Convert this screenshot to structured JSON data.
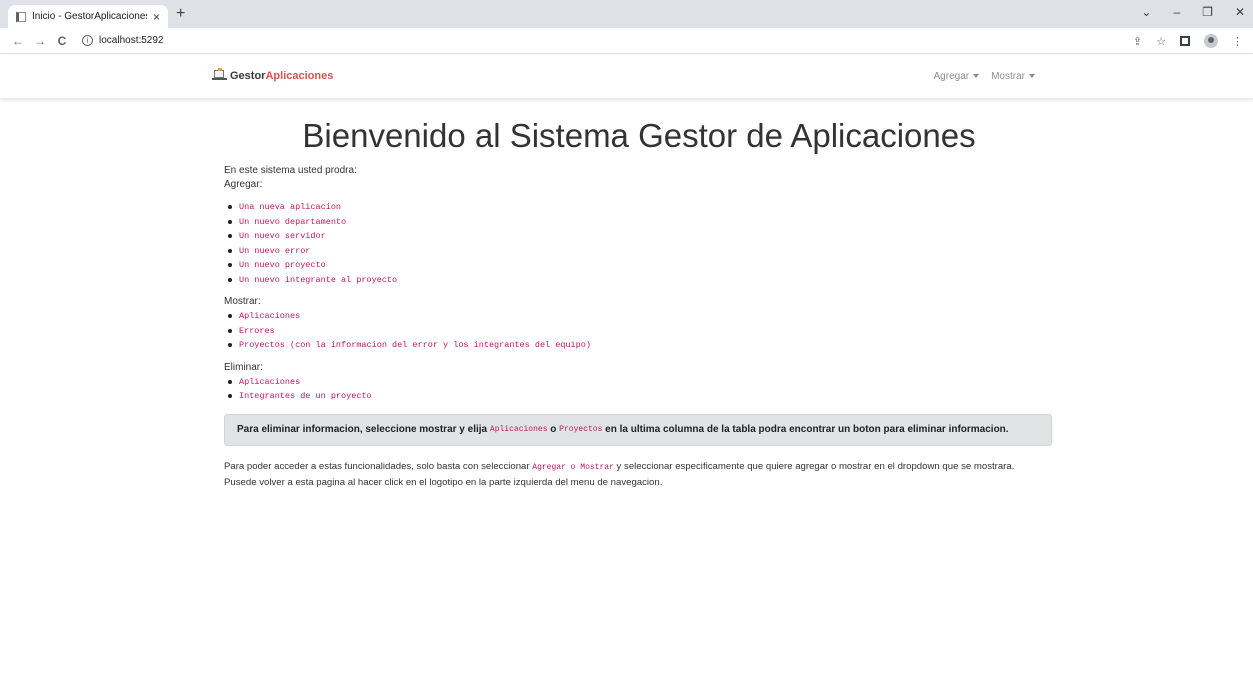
{
  "browser": {
    "tab_title": "Inicio - GestorAplicaciones",
    "tab_close": "×",
    "new_tab": "+",
    "url": "localhost:5292",
    "win_min": "⌄",
    "win_minimize": "–",
    "win_restore": "❐",
    "win_close": "✕",
    "back": "←",
    "forward": "→",
    "reload": "C",
    "share": "⇪",
    "star": "☆",
    "menu": "⋮"
  },
  "navbar": {
    "brand_part1": "Gestor",
    "brand_part2": "Aplicaciones",
    "agregar": "Agregar",
    "mostrar": "Mostrar"
  },
  "main": {
    "heading": "Bienvenido al Sistema Gestor de Aplicaciones",
    "intro": "En este sistema usted prodra:",
    "agregar_label": "Agregar:",
    "agregar_items": [
      "Una nueva aplicacion",
      "Un nuevo departamento",
      "Un nuevo servidor",
      "Un nuevo error",
      "Un nuevo proyecto",
      "Un nuevo integrante al proyecto"
    ],
    "mostrar_label": "Mostrar:",
    "mostrar_items": [
      "Aplicaciones",
      "Errores",
      "Proyectos (con la informacion del error y los integrantes del equipo)"
    ],
    "eliminar_label": "Eliminar:",
    "eliminar_items": [
      "Aplicaciones",
      "Integrantes de un proyecto"
    ],
    "alert": {
      "part1": "Para eliminar informacion, seleccione mostrar y elija ",
      "code1": "Aplicaciones",
      "part2": " o ",
      "code2": "Proyectos",
      "part3": " en la ultima columna de la tabla podra encontrar un boton para eliminar informacion."
    },
    "para1_a": "Para poder acceder a estas funcionalidades, solo basta con seleccionar ",
    "para1_code": "Agregar o Mostrar",
    "para1_b": " y seleccionar especificamente que quiere agregar o mostrar en el dropdown que se mostrara.",
    "para2": "Pusede volver a esta pagina al hacer click en el logotipo en la parte izquierda del menu de navegacion."
  },
  "colors": {
    "accent_code": "#c2185b",
    "brand_accent": "#d9534f",
    "alert_bg": "#e2e3e5"
  }
}
